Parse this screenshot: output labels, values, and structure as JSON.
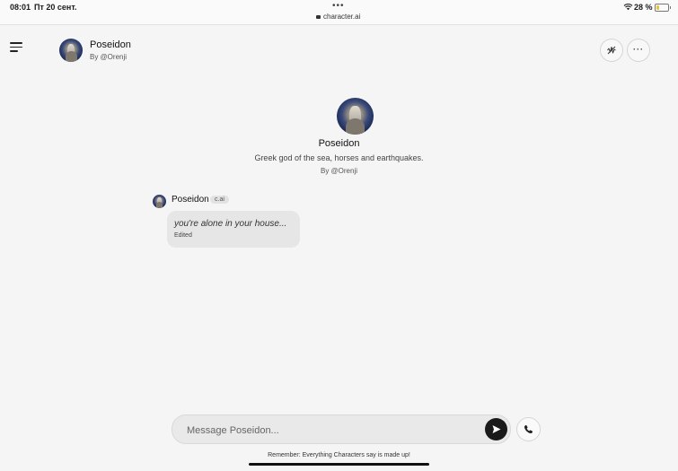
{
  "status_bar": {
    "time": "08:01",
    "date": "Пт 20 сент.",
    "url": "character.ai",
    "battery": "28 %"
  },
  "header": {
    "character_name": "Poseidon",
    "creator": "By @Orenji"
  },
  "intro": {
    "name": "Poseidon",
    "description": "Greek god of the sea, horses and earthquakes.",
    "creator": "By @Orenji"
  },
  "messages": [
    {
      "author": "Poseidon",
      "badge": "c.ai",
      "text": "you're alone in your house...",
      "status": "Edited"
    }
  ],
  "composer": {
    "placeholder": "Message Poseidon..."
  },
  "footer": {
    "disclaimer": "Remember: Everything Characters say is made up!"
  },
  "colors": {
    "background": "#f5f5f5",
    "bubble": "#e6e6e6",
    "send_button": "#1a1a1a",
    "battery_fill": "#e8c43a"
  }
}
